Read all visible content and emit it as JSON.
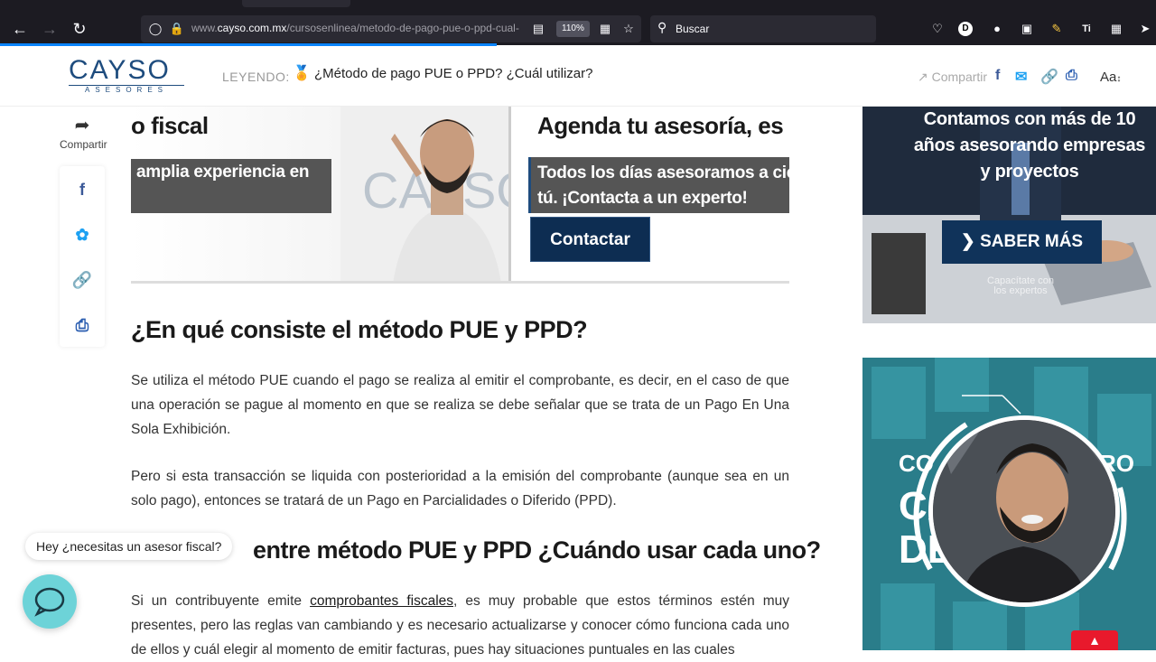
{
  "browser": {
    "url_domain": "cayso.com.mx",
    "url_path": "/cursosenlinea/metodo-de-pago-pue-o-ppd-cual-",
    "url_prefix": "www.",
    "zoom": "110%",
    "search_placeholder": "Buscar",
    "profile_letter": "D",
    "ext_label": "Ti"
  },
  "header": {
    "logo_main": "CAYSO",
    "logo_sub": "ASESORES",
    "reading_label": "LEYENDO:",
    "reading_title": "¿Método de pago PUE o PPD? ¿Cuál utilizar?",
    "share_label": "Compartir",
    "font_size_label": "Aa"
  },
  "sharebar": {
    "label": "Compartir"
  },
  "banner": {
    "left_heading": "o fiscal",
    "left_box": "amplia experiencia en",
    "right_heading": "Agenda tu asesoría, es m",
    "right_box_line1": "Todos los días asesoramos a cie",
    "right_box_line2": "tú. ¡Contacta a un experto!",
    "contact_button": "Contactar"
  },
  "article": {
    "heading1": "¿En qué consiste el método PUE y PPD?",
    "para1": "Se utiliza el método PUE cuando el pago se realiza al emitir el comprobante, es decir, en el caso de que una operación se pague al momento en que se realiza se debe señalar que se trata de un Pago En Una Sola Exhibición.",
    "para2": "Pero si esta transacción se liquida con posterioridad a la emisión del comprobante (aunque sea en un solo pago), entonces se tratará de un Pago en Parcialidades o Diferido (PPD).",
    "heading2": "entre método PUE y PPD ¿Cuándo usar cada uno?",
    "para3_before": "Si un contribuyente emite ",
    "para3_link": "comprobantes fiscales",
    "para3_after": ", es muy probable que estos términos estén muy presentes, pero las reglas van cambiando y es necesario actualizarse y conocer cómo funciona cada uno de ellos y cuál elegir al momento de emitir facturas, pues hay situaciones puntuales en las cuales"
  },
  "sidebar": {
    "ad1_text": "Contamos con más de 10 años asesorando empresas y proyectos",
    "ad1_button": "SABER MÁS",
    "ad1_small": "Capacítate con los expertos",
    "ad2_line1": "CO",
    "ad2_line1_right": "RO",
    "ad2_line2": "CA",
    "ad2_line3": "DE"
  },
  "chat": {
    "bubble": "Hey ¿necesitas un asesor fiscal?"
  },
  "colors": {
    "brand": "#1e4c7e",
    "dark_button": "#0d2d52",
    "facebook": "#3b5998",
    "twitter": "#1da1f2",
    "link_green": "#6bb35b",
    "print": "#2a5db0",
    "scroll_top": "#e8192c"
  }
}
